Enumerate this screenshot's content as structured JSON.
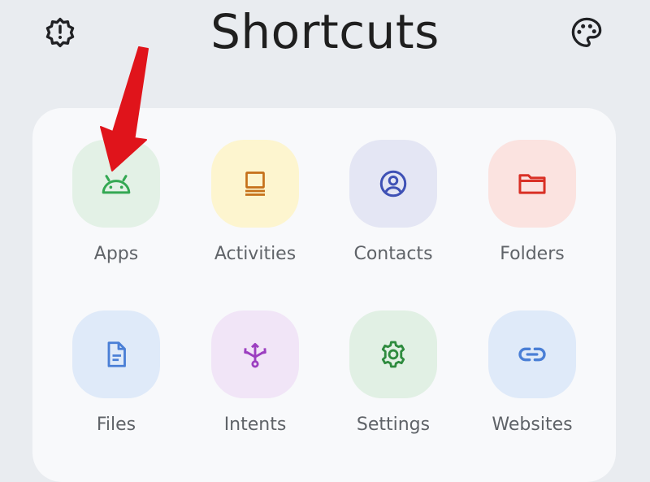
{
  "header": {
    "title": "Shortcuts",
    "left_icon": "gear-alert-icon",
    "right_icon": "palette-icon"
  },
  "colors": {
    "background": "#e9ecf0",
    "card": "#f8f9fb",
    "arrow": "#e0141b"
  },
  "tiles": [
    {
      "label": "Apps",
      "icon": "android-icon",
      "bg": "#e3f1e6",
      "fg": "#34a853"
    },
    {
      "label": "Activities",
      "icon": "activities-icon",
      "bg": "#fdf5cf",
      "fg": "#c5701a"
    },
    {
      "label": "Contacts",
      "icon": "contact-icon",
      "bg": "#e4e6f4",
      "fg": "#3f51b5"
    },
    {
      "label": "Folders",
      "icon": "folder-icon",
      "bg": "#fbe3e0",
      "fg": "#d93025"
    },
    {
      "label": "Files",
      "icon": "file-icon",
      "bg": "#dfeaf9",
      "fg": "#4a7fd6"
    },
    {
      "label": "Intents",
      "icon": "intents-icon",
      "bg": "#f1e5f7",
      "fg": "#9c3fc0"
    },
    {
      "label": "Settings",
      "icon": "settings-gear-icon",
      "bg": "#e1f0e4",
      "fg": "#2e8b3e"
    },
    {
      "label": "Websites",
      "icon": "link-icon",
      "bg": "#dfeaf9",
      "fg": "#4a7fd6"
    }
  ]
}
